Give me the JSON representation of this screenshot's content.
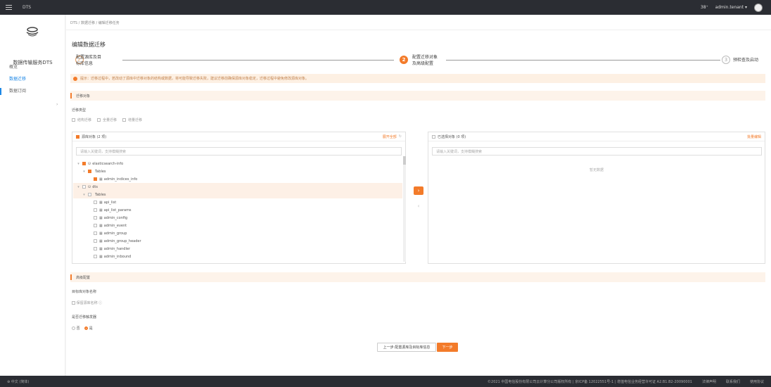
{
  "topbar": {
    "brand": "DTS",
    "bell": "38⁺",
    "user": "admin.tenant ▾"
  },
  "sidebar": {
    "title": "数据传输服务DTS",
    "items": [
      {
        "label": "概览"
      },
      {
        "label": "数据迁移"
      },
      {
        "label": "数据订阅"
      }
    ]
  },
  "main": {
    "breadcrumb": "DTS / 数据迁移 / 编辑迁移任务",
    "title": "编辑数据迁移",
    "steps": [
      {
        "num": "✓",
        "label1": "配置源库及目",
        "label2": "标库信息"
      },
      {
        "num": "2",
        "label1": "配置迁移对象",
        "label2": "及高级配置"
      },
      {
        "num": "3",
        "label1": "预检查及启动",
        "label2": ""
      }
    ],
    "alert": "提示：迁移过程中，若改动了源库中迁移对象的结构或数据，将可能导致迁移失败，建议迁移前确保源库对象稳定，迁移过程中避免修改源库对象。",
    "section1": "迁移对象",
    "migrate_type_label": "迁移类型",
    "migrate_types": [
      "结构迁移",
      "全量迁移",
      "增量迁移"
    ],
    "left_panel": {
      "title": "源库对象 (2 项)",
      "action": "展开全部",
      "search_placeholder": "请输入关键词，支持模糊搜索",
      "tree": [
        {
          "indent": 0,
          "toggle": "▾",
          "check": true,
          "icon": "⛁",
          "label": "elasticsearch-info"
        },
        {
          "indent": 1,
          "toggle": "▾",
          "check": true,
          "icon": "",
          "label": "Tables"
        },
        {
          "indent": 2,
          "toggle": "",
          "check": true,
          "icon": "▦",
          "label": "admin_indices_info"
        },
        {
          "indent": 0,
          "toggle": "▾",
          "check": false,
          "icon": "⛁",
          "label": "dts"
        },
        {
          "indent": 1,
          "toggle": "▾",
          "check": false,
          "icon": "",
          "label": "Tables"
        },
        {
          "indent": 2,
          "toggle": "",
          "check": false,
          "icon": "▦",
          "label": "api_list"
        },
        {
          "indent": 2,
          "toggle": "",
          "check": false,
          "icon": "▦",
          "label": "api_list_params"
        },
        {
          "indent": 2,
          "toggle": "",
          "check": false,
          "icon": "▦",
          "label": "admin_config"
        },
        {
          "indent": 2,
          "toggle": "",
          "check": false,
          "icon": "▦",
          "label": "admin_event"
        },
        {
          "indent": 2,
          "toggle": "",
          "check": false,
          "icon": "▦",
          "label": "admin_group"
        },
        {
          "indent": 2,
          "toggle": "",
          "check": false,
          "icon": "▦",
          "label": "admin_group_header"
        },
        {
          "indent": 2,
          "toggle": "",
          "check": false,
          "icon": "▦",
          "label": "admin_handler"
        },
        {
          "indent": 2,
          "toggle": "",
          "check": false,
          "icon": "▦",
          "label": "admin_inbound"
        }
      ]
    },
    "right_panel": {
      "title": "已选择对象 (0 项)",
      "action": "批量编辑",
      "search_placeholder": "请输入关键词，支持模糊搜索",
      "empty": "暂无数据"
    },
    "section2": "高级配置",
    "adv_label1": "目标库对象名称",
    "adv_opt1": "保留源库名称",
    "adv_label2": "是否迁移触发器",
    "adv_radios": [
      "否",
      "是"
    ],
    "btn_prev": "上一步:配置源库及目标库信息",
    "btn_next": "下一步"
  },
  "footer": {
    "lang": "中文 (简体)",
    "copyright": "©2021 中国电信股份有限公司云计算分公司版权所有 | 京ICP备 12022551号-1 | 增值电信业务经营许可证 A2.B1.B2-20090001",
    "links": [
      "法律声明",
      "联系我们",
      "使用协议"
    ]
  }
}
